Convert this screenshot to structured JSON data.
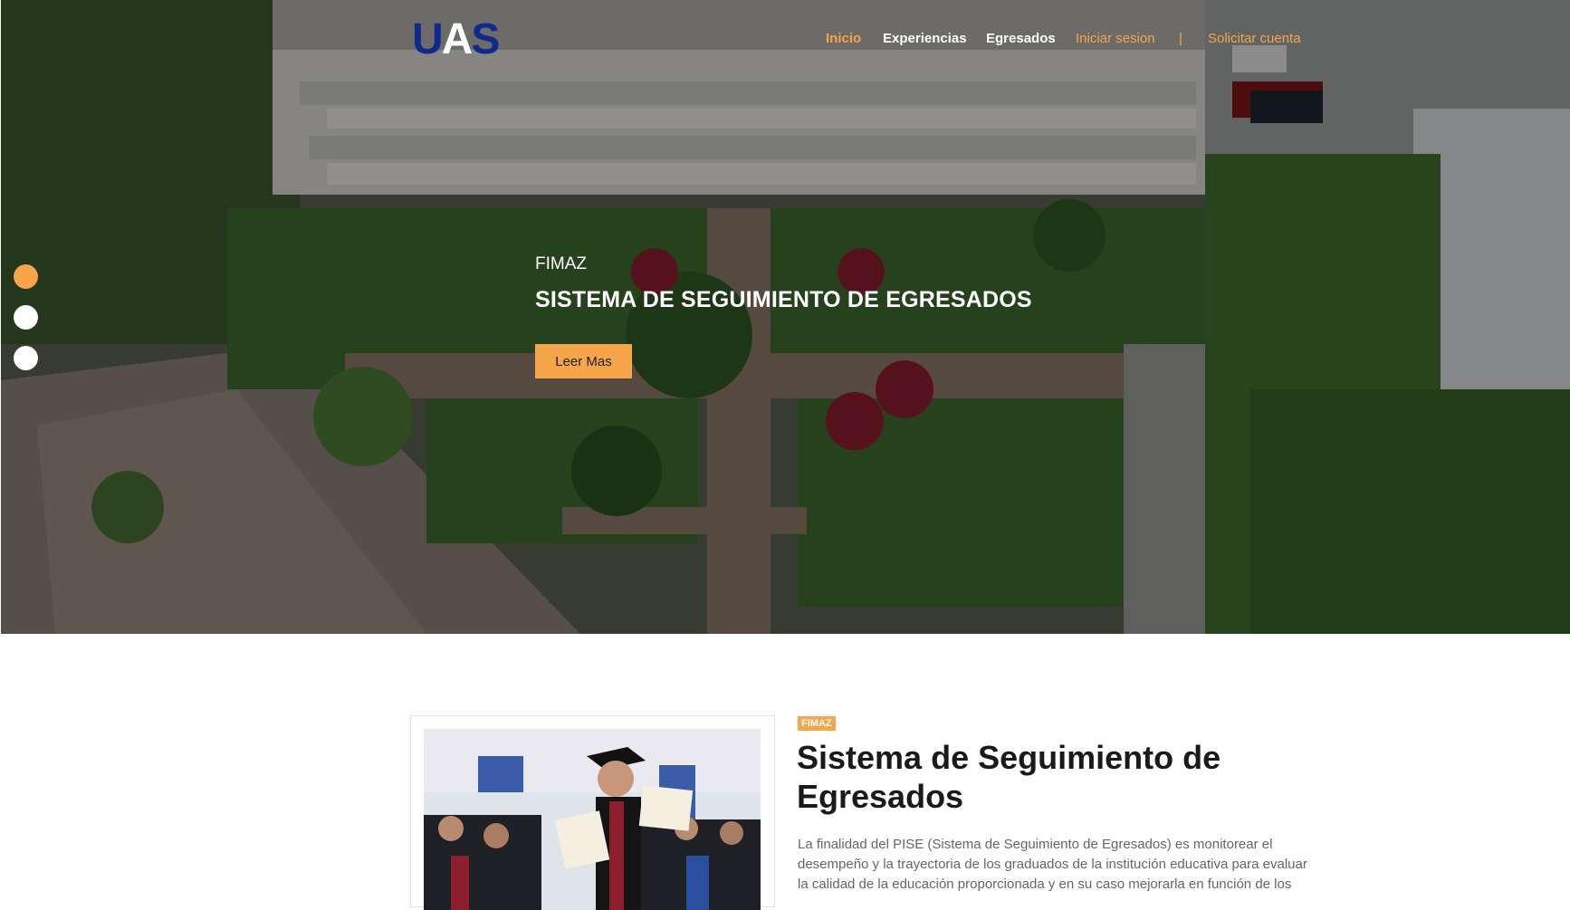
{
  "brand": {
    "logo_letters": [
      "U",
      "A",
      "S"
    ],
    "colors": {
      "accent": "#f6a54a",
      "logo_blue": "#0d2a8c"
    }
  },
  "nav": {
    "items": [
      {
        "label": "Inicio",
        "active": true
      },
      {
        "label": "Experiencias"
      },
      {
        "label": "Egresados"
      },
      {
        "label": "Iniciar sesion"
      },
      {
        "label": "|"
      },
      {
        "label": "Solicitar cuenta"
      }
    ]
  },
  "hero": {
    "kicker": "FIMAZ",
    "title": "SISTEMA DE SEGUIMIENTO DE EGRESADOS",
    "button_label": "Leer Mas",
    "slides": {
      "count": 3,
      "active_index": 0
    }
  },
  "content": {
    "tag": "FIMAZ",
    "title": "Sistema de Seguimiento de Egresados",
    "description": "La finalidad del PISE (Sistema de Seguimiento de Egresados) es monitorear el desempeño y la trayectoria de los graduados de la institución educativa para evaluar la calidad de la educación proporcionada y en su caso mejorarla en función de los"
  }
}
